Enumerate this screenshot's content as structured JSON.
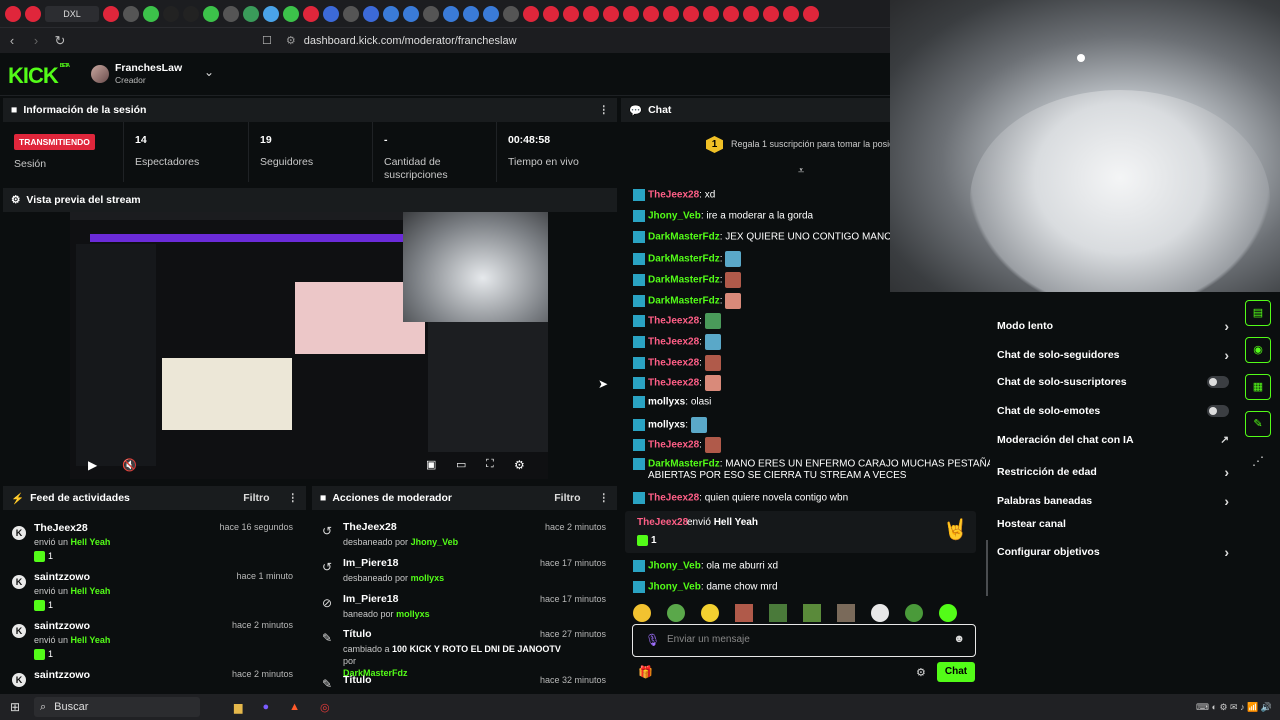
{
  "browser": {
    "url": "dashboard.kick.com/moderator/francheslaw",
    "tab_badge": "DXL"
  },
  "header": {
    "logo": "KICK",
    "beta": "BETA",
    "user_name": "FranchesLaw",
    "user_role": "Creador"
  },
  "session": {
    "title": "Información de la sesión",
    "status_badge": "TRANSMITIENDO",
    "status_label": "Sesión",
    "stats": [
      {
        "value": "14",
        "label": "Espectadores"
      },
      {
        "value": "19",
        "label": "Seguidores"
      },
      {
        "value": "-",
        "label": "Cantidad de suscripciones"
      },
      {
        "value": "00:48:58",
        "label": "Tiempo en vivo"
      }
    ]
  },
  "preview": {
    "title": "Vista previa del stream"
  },
  "feed": {
    "title": "Feed de actividades",
    "filter": "Filtro",
    "items": [
      {
        "name": "TheJeex28",
        "time": "hace 16 segundos",
        "action": "envió un",
        "gift": "Hell Yeah",
        "count": "1"
      },
      {
        "name": "saintzzowo",
        "time": "hace 1 minuto",
        "action": "envió un",
        "gift": "Hell Yeah",
        "count": "1"
      },
      {
        "name": "saintzzowo",
        "time": "hace 2 minutos",
        "action": "envió un",
        "gift": "Hell Yeah",
        "count": "1"
      },
      {
        "name": "saintzzowo",
        "time": "hace 2 minutos",
        "action": "",
        "gift": "",
        "count": ""
      }
    ]
  },
  "mod": {
    "title": "Acciones de moderador",
    "filter": "Filtro",
    "items": [
      {
        "name": "TheJeex28",
        "time": "hace 2 minutos",
        "action": "desbaneado por",
        "by": "Jhony_Veb"
      },
      {
        "name": "Im_Piere18",
        "time": "hace 17 minutos",
        "action": "desbaneado por",
        "by": "mollyxs"
      },
      {
        "name": "Im_Piere18",
        "time": "hace 17 minutos",
        "action": "baneado por",
        "by": "mollyxs"
      },
      {
        "name": "Título",
        "time": "hace 27 minutos",
        "action": "cambiado a",
        "detail": "100 KICK Y ROTO EL DNI DE JANOOTV",
        "by_word": "por",
        "by": "DarkMasterFdz"
      },
      {
        "name": "Título",
        "time": "hace 32 minutos",
        "action": "",
        "by": ""
      }
    ]
  },
  "chat": {
    "title": "Chat",
    "pinned": "Regala 1 suscripción para tomar la posici",
    "pinned_rank": "1",
    "messages": [
      {
        "user": "TheJeex28",
        "text": "xd",
        "color": "#ff5f87"
      },
      {
        "user": "Jhony_Veb",
        "text": "ire a moderar a la gorda",
        "color": "#53fc18"
      },
      {
        "user": "DarkMasterFdz",
        "text": "JEX QUIERE UNO CONTIGO MANO",
        "color": "#53fc18"
      },
      {
        "user": "DarkMasterFdz",
        "text": "",
        "color": "#53fc18"
      },
      {
        "user": "DarkMasterFdz",
        "text": "",
        "color": "#53fc18"
      },
      {
        "user": "DarkMasterFdz",
        "text": "",
        "color": "#53fc18"
      },
      {
        "user": "TheJeex28",
        "text": "",
        "color": "#ff5f87"
      },
      {
        "user": "TheJeex28",
        "text": "",
        "color": "#ff5f87"
      },
      {
        "user": "TheJeex28",
        "text": "",
        "color": "#ff5f87"
      },
      {
        "user": "TheJeex28",
        "text": "",
        "color": "#ff5f87"
      },
      {
        "user": "mollyxs",
        "text": "olasi",
        "color": "#ffffff"
      },
      {
        "user": "mollyxs",
        "text": "",
        "color": "#ffffff"
      },
      {
        "user": "TheJeex28",
        "text": "",
        "color": "#ff5f87"
      },
      {
        "user": "DarkMasterFdz",
        "text": "MANO ERES UN ENFERMO CARAJO MUCHAS PESTAÑAS",
        "text2": "ABIERTAS POR ESO SE CIERRA TU STREAM A VECES",
        "color": "#53fc18"
      },
      {
        "user": "TheJeex28",
        "text": "quien quiere novela contigo wbn",
        "color": "#ff5f87"
      }
    ],
    "gift_user": "TheJeex28",
    "gift_text": "envió",
    "gift_name": "Hell Yeah",
    "gift_count": "1",
    "messages2": [
      {
        "user": "Jhony_Veb",
        "text": "ola me aburri xd"
      },
      {
        "user": "Jhony_Veb",
        "text": "dame chow mrd"
      }
    ],
    "input_placeholder": "Enviar un mensaje",
    "send": "Chat"
  },
  "settings": {
    "items": [
      {
        "label": "Modo lento",
        "control": "arrow"
      },
      {
        "label": "Chat de solo-seguidores",
        "control": "arrow"
      },
      {
        "label": "Chat de solo-suscriptores",
        "control": "toggle"
      },
      {
        "label": "Chat de solo-emotes",
        "control": "toggle"
      },
      {
        "label": "Moderación del chat con IA",
        "control": "external"
      },
      {
        "label": "Restricción de edad",
        "control": "arrow"
      },
      {
        "label": "Palabras baneadas",
        "control": "arrow"
      },
      {
        "label": "Hostear canal",
        "control": "none"
      },
      {
        "label": "Configurar objetivos",
        "control": "arrow"
      }
    ]
  },
  "taskbar": {
    "search": "Buscar"
  },
  "colors": {
    "accent": "#53fc18",
    "live": "#e0263b",
    "panel_head": "#191c1e"
  }
}
